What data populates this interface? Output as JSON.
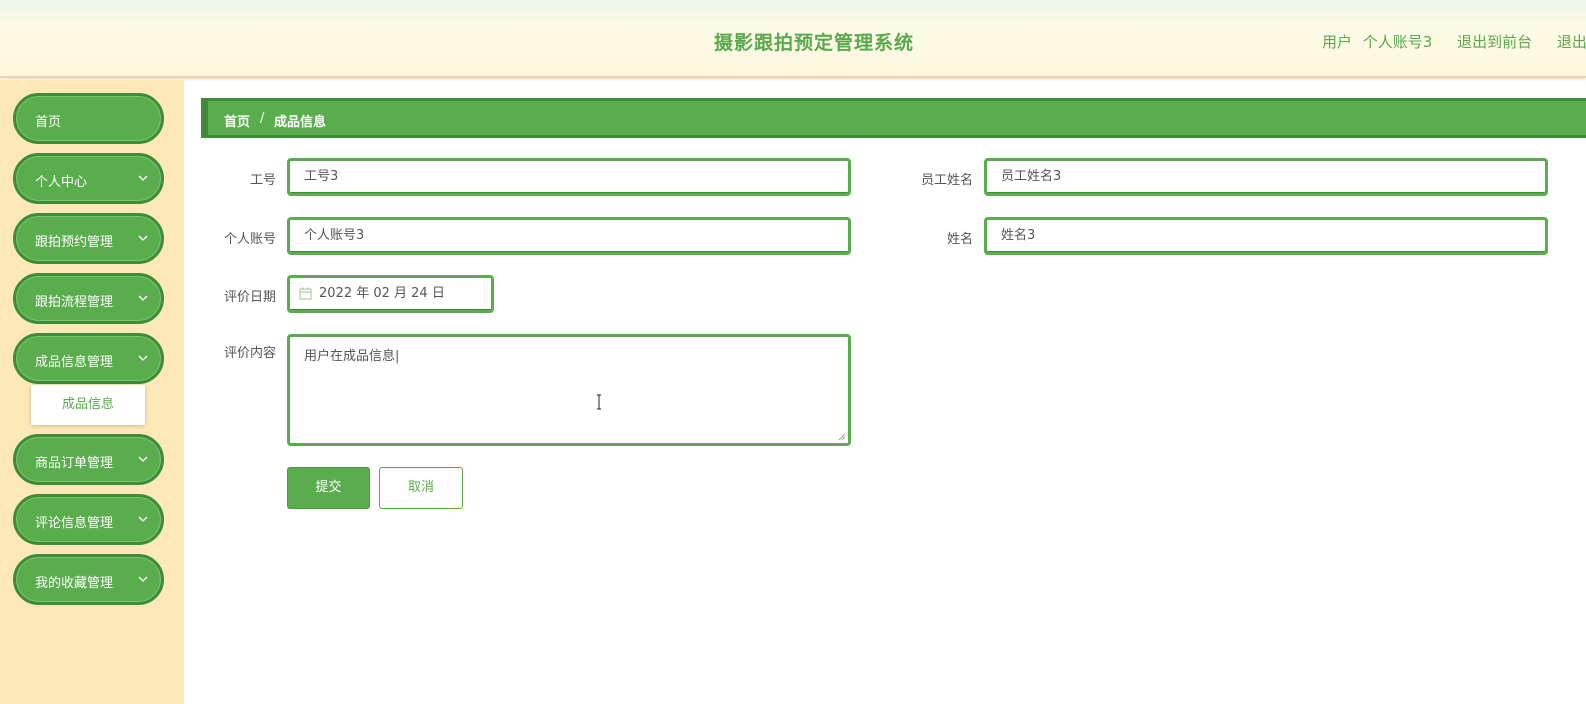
{
  "header": {
    "title": "摄影跟拍预定管理系统",
    "user_prefix": "用户",
    "user_account": "个人账号3",
    "to_front": "退出到前台",
    "logout": "退出登录"
  },
  "sidebar": {
    "items": [
      {
        "label": "首页"
      },
      {
        "label": "个人中心"
      },
      {
        "label": "跟拍预约管理"
      },
      {
        "label": "跟拍流程管理"
      },
      {
        "label": "成品信息管理"
      },
      {
        "label": "商品订单管理"
      },
      {
        "label": "评论信息管理"
      },
      {
        "label": "我的收藏管理"
      }
    ],
    "submenu_label": "成品信息"
  },
  "breadcrumb": {
    "home": "首页",
    "separator": "/",
    "current": "成品信息"
  },
  "form": {
    "job_id": {
      "label": "工号",
      "value": "工号3"
    },
    "employee_name": {
      "label": "员工姓名",
      "value": "员工姓名3"
    },
    "account": {
      "label": "个人账号",
      "value": "个人账号3"
    },
    "name": {
      "label": "姓名",
      "value": "姓名3"
    },
    "review_date": {
      "label": "评价日期",
      "value": "2022 年 02 月 24 日"
    },
    "review_content": {
      "label": "评价内容",
      "value": "用户在成品信息|"
    },
    "submit_label": "提交",
    "cancel_label": "取消"
  },
  "colors": {
    "accent": "#5aad4d",
    "accent_dark": "#3e8c37",
    "sidebar_bg": "#fde8b8"
  }
}
